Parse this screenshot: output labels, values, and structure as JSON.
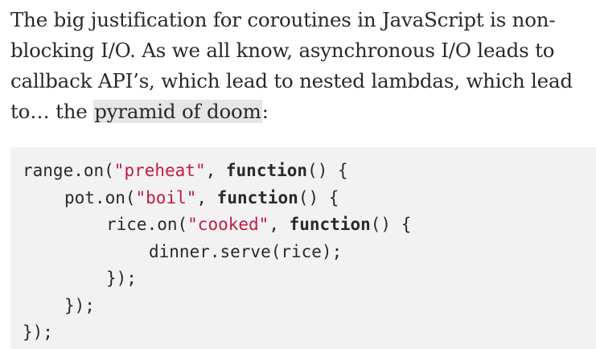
{
  "article": {
    "paragraph": {
      "before_link": "The big justification for coroutines in JavaScript is non-blocking I/O. As we all know, asynchronous I/O leads to callback API’s, which lead to nested lambdas, which lead to… the ",
      "link_text": "pyramid of doom",
      "after_link": ":"
    },
    "code": {
      "lines": [
        {
          "a": "range.on(",
          "str": "\"preheat\"",
          "b": ", ",
          "kw": "function",
          "c": "() {"
        },
        {
          "a": "pot.on(",
          "str": "\"boil\"",
          "b": ", ",
          "kw": "function",
          "c": "() {"
        },
        {
          "a": "rice.on(",
          "str": "\"cooked\"",
          "b": ", ",
          "kw": "function",
          "c": "() {"
        },
        {
          "text": "dinner.serve(rice);"
        },
        {
          "text": "});"
        },
        {
          "text": "});"
        },
        {
          "text": "});"
        }
      ]
    },
    "colors": {
      "string": "#c41a44",
      "code_background": "#f2f2f2",
      "link_highlight": "#e6e6e6",
      "text": "#292929"
    }
  }
}
